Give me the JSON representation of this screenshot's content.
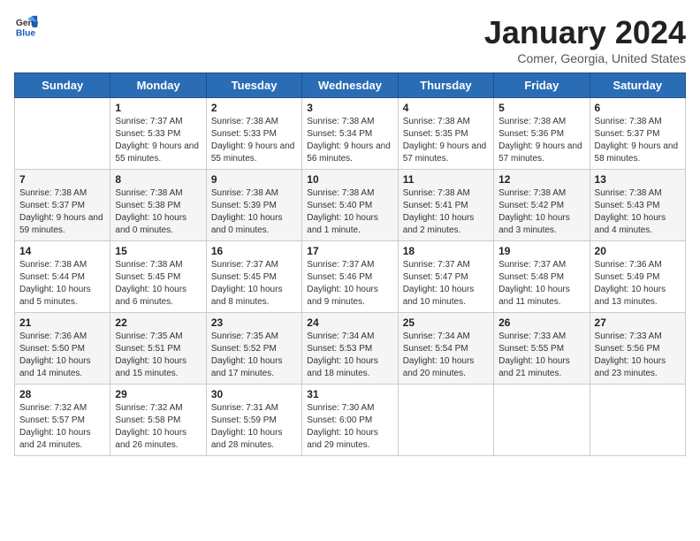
{
  "header": {
    "logo_general": "General",
    "logo_blue": "Blue",
    "month_title": "January 2024",
    "location": "Comer, Georgia, United States"
  },
  "days_of_week": [
    "Sunday",
    "Monday",
    "Tuesday",
    "Wednesday",
    "Thursday",
    "Friday",
    "Saturday"
  ],
  "weeks": [
    [
      {
        "day": "",
        "sunrise": "",
        "sunset": "",
        "daylight": ""
      },
      {
        "day": "1",
        "sunrise": "Sunrise: 7:37 AM",
        "sunset": "Sunset: 5:33 PM",
        "daylight": "Daylight: 9 hours and 55 minutes."
      },
      {
        "day": "2",
        "sunrise": "Sunrise: 7:38 AM",
        "sunset": "Sunset: 5:33 PM",
        "daylight": "Daylight: 9 hours and 55 minutes."
      },
      {
        "day": "3",
        "sunrise": "Sunrise: 7:38 AM",
        "sunset": "Sunset: 5:34 PM",
        "daylight": "Daylight: 9 hours and 56 minutes."
      },
      {
        "day": "4",
        "sunrise": "Sunrise: 7:38 AM",
        "sunset": "Sunset: 5:35 PM",
        "daylight": "Daylight: 9 hours and 57 minutes."
      },
      {
        "day": "5",
        "sunrise": "Sunrise: 7:38 AM",
        "sunset": "Sunset: 5:36 PM",
        "daylight": "Daylight: 9 hours and 57 minutes."
      },
      {
        "day": "6",
        "sunrise": "Sunrise: 7:38 AM",
        "sunset": "Sunset: 5:37 PM",
        "daylight": "Daylight: 9 hours and 58 minutes."
      }
    ],
    [
      {
        "day": "7",
        "sunrise": "Sunrise: 7:38 AM",
        "sunset": "Sunset: 5:37 PM",
        "daylight": "Daylight: 9 hours and 59 minutes."
      },
      {
        "day": "8",
        "sunrise": "Sunrise: 7:38 AM",
        "sunset": "Sunset: 5:38 PM",
        "daylight": "Daylight: 10 hours and 0 minutes."
      },
      {
        "day": "9",
        "sunrise": "Sunrise: 7:38 AM",
        "sunset": "Sunset: 5:39 PM",
        "daylight": "Daylight: 10 hours and 0 minutes."
      },
      {
        "day": "10",
        "sunrise": "Sunrise: 7:38 AM",
        "sunset": "Sunset: 5:40 PM",
        "daylight": "Daylight: 10 hours and 1 minute."
      },
      {
        "day": "11",
        "sunrise": "Sunrise: 7:38 AM",
        "sunset": "Sunset: 5:41 PM",
        "daylight": "Daylight: 10 hours and 2 minutes."
      },
      {
        "day": "12",
        "sunrise": "Sunrise: 7:38 AM",
        "sunset": "Sunset: 5:42 PM",
        "daylight": "Daylight: 10 hours and 3 minutes."
      },
      {
        "day": "13",
        "sunrise": "Sunrise: 7:38 AM",
        "sunset": "Sunset: 5:43 PM",
        "daylight": "Daylight: 10 hours and 4 minutes."
      }
    ],
    [
      {
        "day": "14",
        "sunrise": "Sunrise: 7:38 AM",
        "sunset": "Sunset: 5:44 PM",
        "daylight": "Daylight: 10 hours and 5 minutes."
      },
      {
        "day": "15",
        "sunrise": "Sunrise: 7:38 AM",
        "sunset": "Sunset: 5:45 PM",
        "daylight": "Daylight: 10 hours and 6 minutes."
      },
      {
        "day": "16",
        "sunrise": "Sunrise: 7:37 AM",
        "sunset": "Sunset: 5:45 PM",
        "daylight": "Daylight: 10 hours and 8 minutes."
      },
      {
        "day": "17",
        "sunrise": "Sunrise: 7:37 AM",
        "sunset": "Sunset: 5:46 PM",
        "daylight": "Daylight: 10 hours and 9 minutes."
      },
      {
        "day": "18",
        "sunrise": "Sunrise: 7:37 AM",
        "sunset": "Sunset: 5:47 PM",
        "daylight": "Daylight: 10 hours and 10 minutes."
      },
      {
        "day": "19",
        "sunrise": "Sunrise: 7:37 AM",
        "sunset": "Sunset: 5:48 PM",
        "daylight": "Daylight: 10 hours and 11 minutes."
      },
      {
        "day": "20",
        "sunrise": "Sunrise: 7:36 AM",
        "sunset": "Sunset: 5:49 PM",
        "daylight": "Daylight: 10 hours and 13 minutes."
      }
    ],
    [
      {
        "day": "21",
        "sunrise": "Sunrise: 7:36 AM",
        "sunset": "Sunset: 5:50 PM",
        "daylight": "Daylight: 10 hours and 14 minutes."
      },
      {
        "day": "22",
        "sunrise": "Sunrise: 7:35 AM",
        "sunset": "Sunset: 5:51 PM",
        "daylight": "Daylight: 10 hours and 15 minutes."
      },
      {
        "day": "23",
        "sunrise": "Sunrise: 7:35 AM",
        "sunset": "Sunset: 5:52 PM",
        "daylight": "Daylight: 10 hours and 17 minutes."
      },
      {
        "day": "24",
        "sunrise": "Sunrise: 7:34 AM",
        "sunset": "Sunset: 5:53 PM",
        "daylight": "Daylight: 10 hours and 18 minutes."
      },
      {
        "day": "25",
        "sunrise": "Sunrise: 7:34 AM",
        "sunset": "Sunset: 5:54 PM",
        "daylight": "Daylight: 10 hours and 20 minutes."
      },
      {
        "day": "26",
        "sunrise": "Sunrise: 7:33 AM",
        "sunset": "Sunset: 5:55 PM",
        "daylight": "Daylight: 10 hours and 21 minutes."
      },
      {
        "day": "27",
        "sunrise": "Sunrise: 7:33 AM",
        "sunset": "Sunset: 5:56 PM",
        "daylight": "Daylight: 10 hours and 23 minutes."
      }
    ],
    [
      {
        "day": "28",
        "sunrise": "Sunrise: 7:32 AM",
        "sunset": "Sunset: 5:57 PM",
        "daylight": "Daylight: 10 hours and 24 minutes."
      },
      {
        "day": "29",
        "sunrise": "Sunrise: 7:32 AM",
        "sunset": "Sunset: 5:58 PM",
        "daylight": "Daylight: 10 hours and 26 minutes."
      },
      {
        "day": "30",
        "sunrise": "Sunrise: 7:31 AM",
        "sunset": "Sunset: 5:59 PM",
        "daylight": "Daylight: 10 hours and 28 minutes."
      },
      {
        "day": "31",
        "sunrise": "Sunrise: 7:30 AM",
        "sunset": "Sunset: 6:00 PM",
        "daylight": "Daylight: 10 hours and 29 minutes."
      },
      {
        "day": "",
        "sunrise": "",
        "sunset": "",
        "daylight": ""
      },
      {
        "day": "",
        "sunrise": "",
        "sunset": "",
        "daylight": ""
      },
      {
        "day": "",
        "sunrise": "",
        "sunset": "",
        "daylight": ""
      }
    ]
  ]
}
